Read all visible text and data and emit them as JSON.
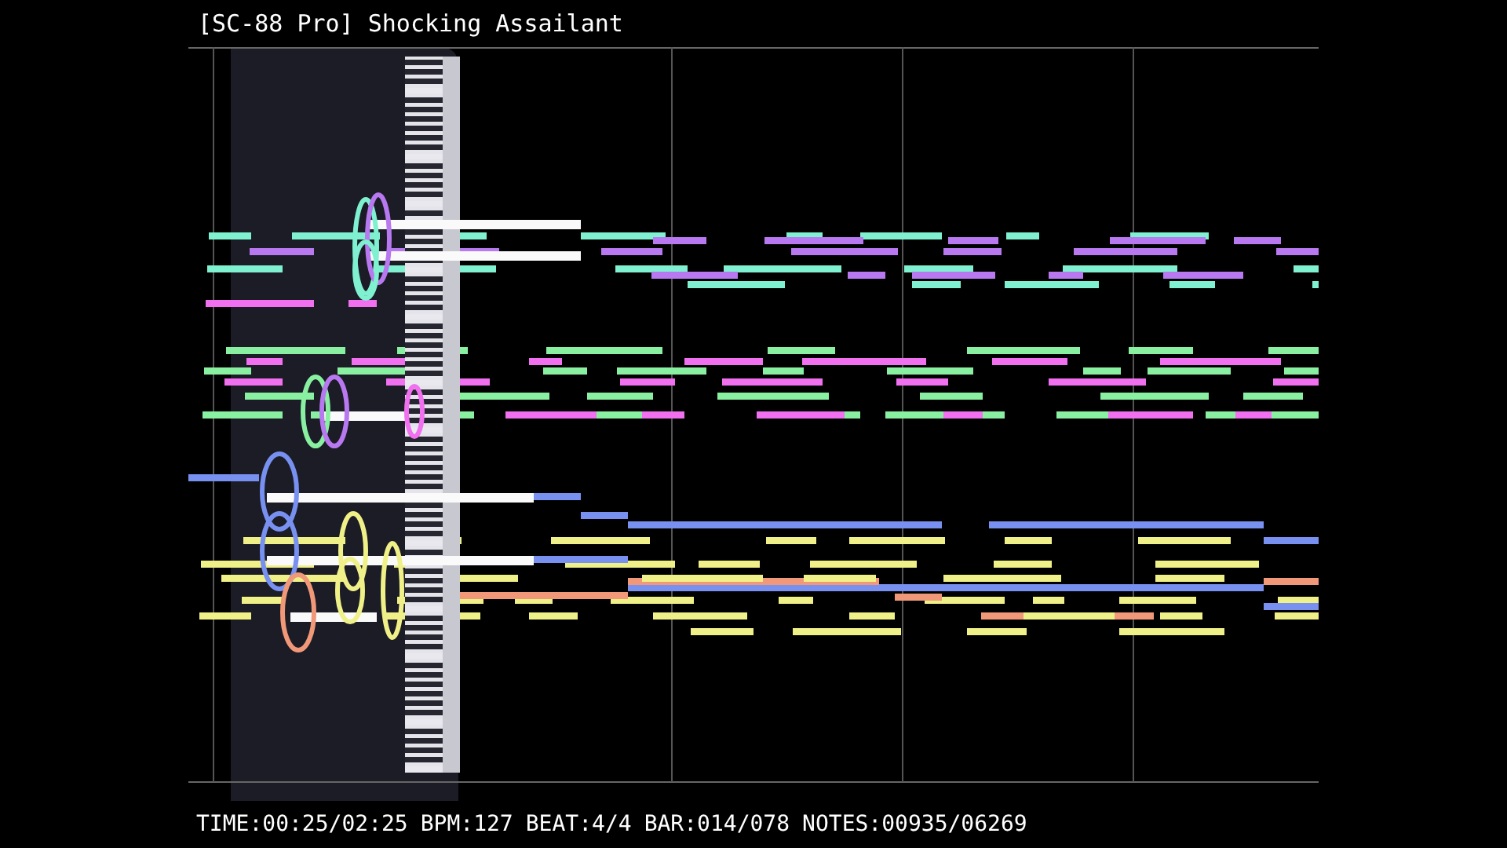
{
  "title": "[SC-88 Pro] Shocking Assailant",
  "status_bar": [
    "TIME:00:25/02:25",
    "BPM:127",
    "BEAT:4/4",
    "BAR:014/078",
    "NOTES:00935/06269"
  ]
}
